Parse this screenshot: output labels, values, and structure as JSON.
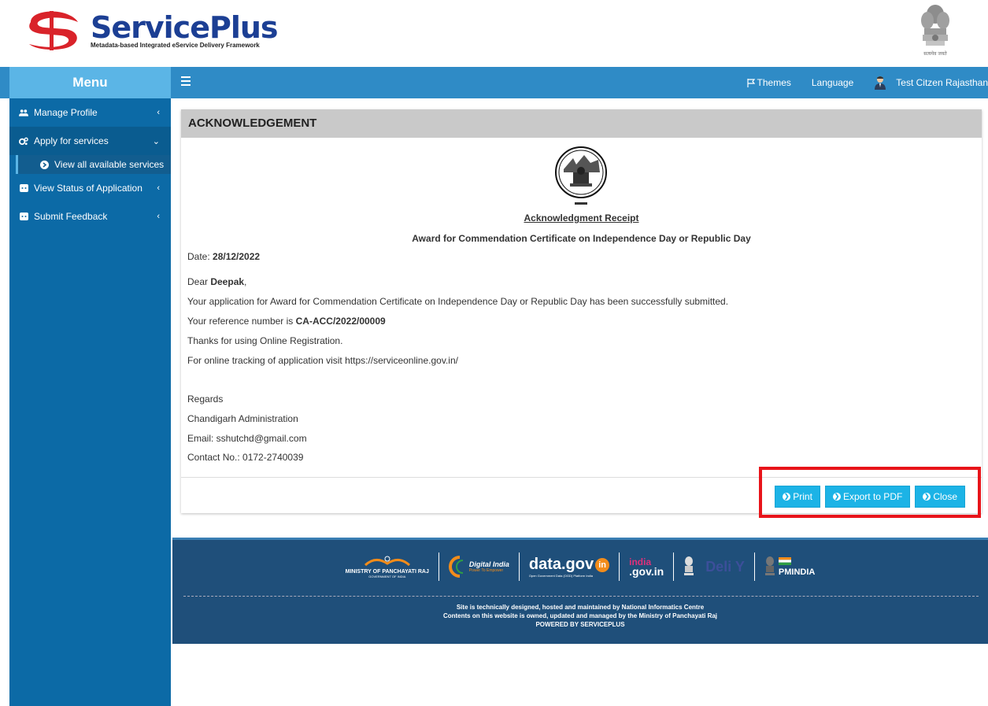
{
  "brand": {
    "title_part1": "Service",
    "title_part2": "Plus",
    "subtitle": "Metadata-based Integrated eService Delivery Framework",
    "emblem_motto": "सत्यमेव जयते"
  },
  "topnav": {
    "menu_label": "Menu",
    "themes_label": "Themes",
    "language_label": "Language",
    "user_name": "Test Citzen Rajasthan"
  },
  "sidebar": {
    "items": [
      {
        "label": "Manage Profile",
        "icon": "users-icon"
      },
      {
        "label": "Apply for services",
        "icon": "cogs-icon"
      },
      {
        "label": "View Status of Application",
        "icon": "status-icon"
      },
      {
        "label": "Submit Feedback",
        "icon": "feedback-icon"
      }
    ],
    "sub_item": "View all available services"
  },
  "panel": {
    "header": "ACKNOWLEDGEMENT",
    "receipt_title": "Acknowledgment Receipt",
    "service_name": "Award for Commendation Certificate on Independence Day or Republic Day",
    "date_label": "Date: ",
    "date_value": "28/12/2022",
    "dear_label": "Dear ",
    "applicant_name": "Deepak",
    "dear_suffix": ",",
    "submitted_text": "Your application for Award for Commendation Certificate on Independence Day or Republic Day has been successfully submitted.",
    "reference_label": "Your reference number is ",
    "reference_number": "CA-ACC/2022/00009",
    "thanks_text": "Thanks for using Online Registration.",
    "tracking_text": "For online tracking of application visit https://serviceonline.gov.in/",
    "regards": "Regards",
    "office": "Chandigarh Administration",
    "email": "Email: sshutchd@gmail.com",
    "contact": "Contact No.: 0172-2740039",
    "buttons": {
      "print": "Print",
      "export": "Export to PDF",
      "close": "Close"
    }
  },
  "footer": {
    "logos": {
      "mopr_title": "MINISTRY OF PANCHAYATI RAJ",
      "mopr_sub": "GOVERNMENT OF INDIA",
      "digital_india": "Digital India",
      "digital_india_sub": "Power To Empower",
      "datagov": "data.gov",
      "datagov_in": "in",
      "datagov_sub": "Open Government Data (OGD) Platform India",
      "indiagov_top": "india",
      "indiagov_bottom": ".gov.in",
      "delhy": "Deli Y",
      "pmindia": "PMINDIA"
    },
    "line1": "Site is technically designed, hosted and maintained by National Informatics Centre",
    "line2": "Contents on this website is owned, updated and managed by the Ministry of Panchayati Raj",
    "line3": "POWERED BY SERVICEPLUS"
  },
  "colors": {
    "topnav": "#2f8bc6",
    "menu_head": "#5bb5e6",
    "sidebar": "#0c6aa6",
    "button": "#1cb3e6",
    "highlight": "#e8141a",
    "footer": "#1f4f7a"
  }
}
